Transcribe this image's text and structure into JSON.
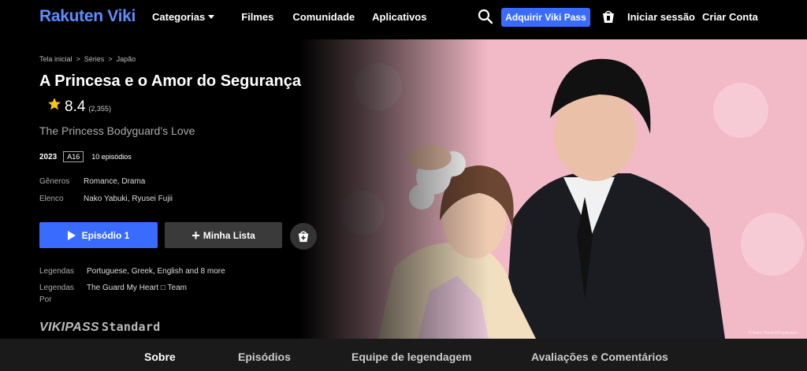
{
  "header": {
    "logo_part1": "Rakuten ",
    "logo_part2": "Viki",
    "nav": [
      {
        "label": "Categorias"
      },
      {
        "label": "Filmes"
      },
      {
        "label": "Comunidade"
      },
      {
        "label": "Aplicativos"
      }
    ],
    "vikipass_button": "Adquirir Viki Pass",
    "login": "Iniciar sessão",
    "signup": "Criar Conta",
    "icons": {
      "search": "search-icon",
      "bucket": "collection-bucket-icon"
    }
  },
  "breadcrumb": [
    "Tela inicial",
    ">",
    "Séries",
    ">",
    "Japão"
  ],
  "show": {
    "title": "A Princesa e o Amor do Segurança",
    "rating": "8.4",
    "rating_count": "(2,355)",
    "original_title": "The Princess Bodyguard’s Love",
    "year": "2023",
    "age": "A16",
    "episodes": "10 episódios",
    "genres_label": "Gêneros",
    "genres": "Romance, Drama",
    "cast_label": "Elenco",
    "cast": "Nako Yabuki, Ryusei Fujii"
  },
  "actions": {
    "play_label": "Episódio 1",
    "list_label": "Minha Lista",
    "list_plus": "+"
  },
  "subtitles": {
    "label": "Legendas",
    "value": "Portuguese, Greek, English and 8 more",
    "by_label": "Legendas Por",
    "by_label_line1": "Legendas",
    "by_label_line2": "Por",
    "by_value": "The Guard My Heart □ Team"
  },
  "vikipass": {
    "brand": "VIKIPASS",
    "tier": "Standard"
  },
  "hero_credit": "© Nako Yabuki/Shogakukan...",
  "tabs": [
    {
      "label": "Sobre",
      "active": true
    },
    {
      "label": "Episódios",
      "active": false
    },
    {
      "label": "Equipe de legendagem",
      "active": false
    },
    {
      "label": "Avaliações e Comentários",
      "active": false
    }
  ],
  "colors": {
    "accent": "#3a6bff",
    "logo": "#5d8dff",
    "star": "#f5c518",
    "hero_bg": "#f2b9c6"
  }
}
